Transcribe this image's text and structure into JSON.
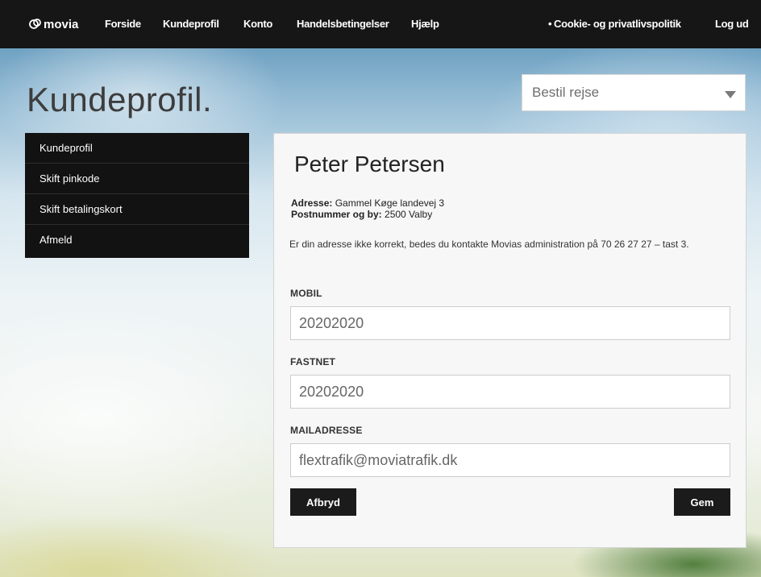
{
  "nav": {
    "logo": "movia",
    "items": [
      "Forside",
      "Kundeprofil",
      "Konto",
      "Handelsbetingelser",
      "Hjælp"
    ],
    "cookie": "Cookie- og privatlivspolitik",
    "logout": "Log ud"
  },
  "page": {
    "title": "Kundeprofil."
  },
  "dropdown": {
    "selected": "Bestil rejse"
  },
  "sidebar": {
    "items": [
      "Kundeprofil",
      "Skift pinkode",
      "Skift betalingskort",
      "Afmeld"
    ]
  },
  "profile": {
    "name": "Peter Petersen",
    "address_label": "Adresse:",
    "address_value": "Gammel Køge landevej 3",
    "postal_label": "Postnummer og by:",
    "postal_value": "2500 Valby",
    "notice": "Er din adresse ikke korrekt, bedes du kontakte Movias administration på 70 26 27 27 – tast 3."
  },
  "form": {
    "mobil_label": "MOBIL",
    "mobil_value": "20202020",
    "fastnet_label": "FASTNET",
    "fastnet_value": "20202020",
    "mail_label": "MAILADRESSE",
    "mail_value": "flextrafik@moviatrafik.dk"
  },
  "buttons": {
    "cancel": "Afbryd",
    "save": "Gem"
  },
  "colors": {
    "nav_bg": "#161616",
    "sidebar_bg": "#121212",
    "button_bg": "#1b1b1b",
    "card_bg": "#f7f7f7"
  }
}
